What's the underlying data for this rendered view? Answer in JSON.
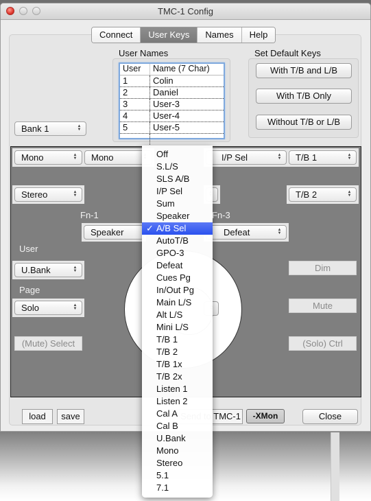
{
  "window": {
    "title": "TMC-1 Config"
  },
  "tabs": [
    {
      "label": "Connect",
      "active": false
    },
    {
      "label": "User Keys",
      "active": true
    },
    {
      "label": "Names",
      "active": false
    },
    {
      "label": "Help",
      "active": false
    }
  ],
  "user_names": {
    "label": "User Names",
    "columns": [
      "User",
      "Name (7 Char)"
    ],
    "rows": [
      {
        "user": "1",
        "name": "Colin"
      },
      {
        "user": "2",
        "name": "Daniel"
      },
      {
        "user": "3",
        "name": "User-3"
      },
      {
        "user": "4",
        "name": "User-4"
      },
      {
        "user": "5",
        "name": "User-5"
      }
    ]
  },
  "default_keys": {
    "label": "Set Default Keys",
    "buttons": [
      "With T/B and L/B",
      "With T/B Only",
      "Without T/B or L/B"
    ]
  },
  "bank_select": {
    "value": "Bank 1"
  },
  "keys": {
    "row1": [
      "Mono",
      "Mono",
      "I/P Sel",
      "T/B 1"
    ],
    "stereo": "Stereo",
    "tb2": "T/B 2",
    "fn1_label": "Fn-1",
    "fn1_value": "Speaker",
    "fn3_label": "Fn-3",
    "fn3_value": "Defeat",
    "user_label": "User",
    "user_value": "U.Bank",
    "page_label": "Page",
    "page_value": "Solo",
    "mute_select": "(Mute) Select",
    "dim": "Dim",
    "mute": "Mute",
    "solo_ctrl": "(Solo) Ctrl"
  },
  "footer": {
    "load": "load",
    "save": "save",
    "send_to": "Send to TMC-1",
    "xmon": "-XMon",
    "close": "Close"
  },
  "dropdown_menu": {
    "selected": "A/B Sel",
    "check_glyph": "✓",
    "items": [
      "Off",
      "S.L/S",
      "SLS A/B",
      "I/P Sel",
      "Sum",
      "Speaker",
      "A/B Sel",
      "AutoT/B",
      "GPO-3",
      "Defeat",
      "Cues Pg",
      "In/Out Pg",
      "Main L/S",
      "Alt L/S",
      "Mini L/S",
      "T/B 1",
      "T/B 2",
      "T/B 1x",
      "T/B 2x",
      "Listen 1",
      "Listen 2",
      "Cal A",
      "Cal B",
      "U.Bank",
      "Mono",
      "Stereo",
      "5.1",
      "7.1"
    ]
  }
}
